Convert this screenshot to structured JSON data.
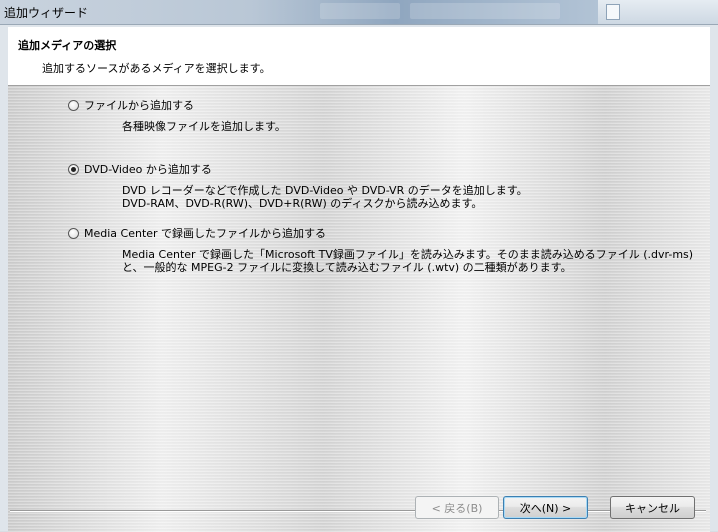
{
  "window": {
    "title": "追加ウィザード"
  },
  "header": {
    "title": "追加メディアの選択",
    "subtitle": "追加するソースがあるメディアを選択します。"
  },
  "options": [
    {
      "label": "ファイルから追加する",
      "checked": false,
      "description_lines": [
        "各種映像ファイルを追加します。"
      ]
    },
    {
      "label": "DVD-Video から追加する",
      "checked": true,
      "description_lines": [
        "DVD レコーダーなどで作成した DVD-Video や DVD-VR のデータを追加します。",
        "DVD-RAM、DVD-R(RW)、DVD+R(RW) のディスクから読み込めます。"
      ]
    },
    {
      "label": "Media Center で録画したファイルから追加する",
      "checked": false,
      "description_lines": [
        "Media Center で録画した「Microsoft TV録画ファイル」を読み込みます。そのまま読み込めるファイル (.dvr-ms)",
        "と、一般的な MPEG-2 ファイルに変換して読み込むファイル (.wtv) の二種類があります。"
      ]
    }
  ],
  "buttons": {
    "back": "< 戻る(B)",
    "next": "次へ(N) >",
    "cancel": "キャンセル"
  }
}
